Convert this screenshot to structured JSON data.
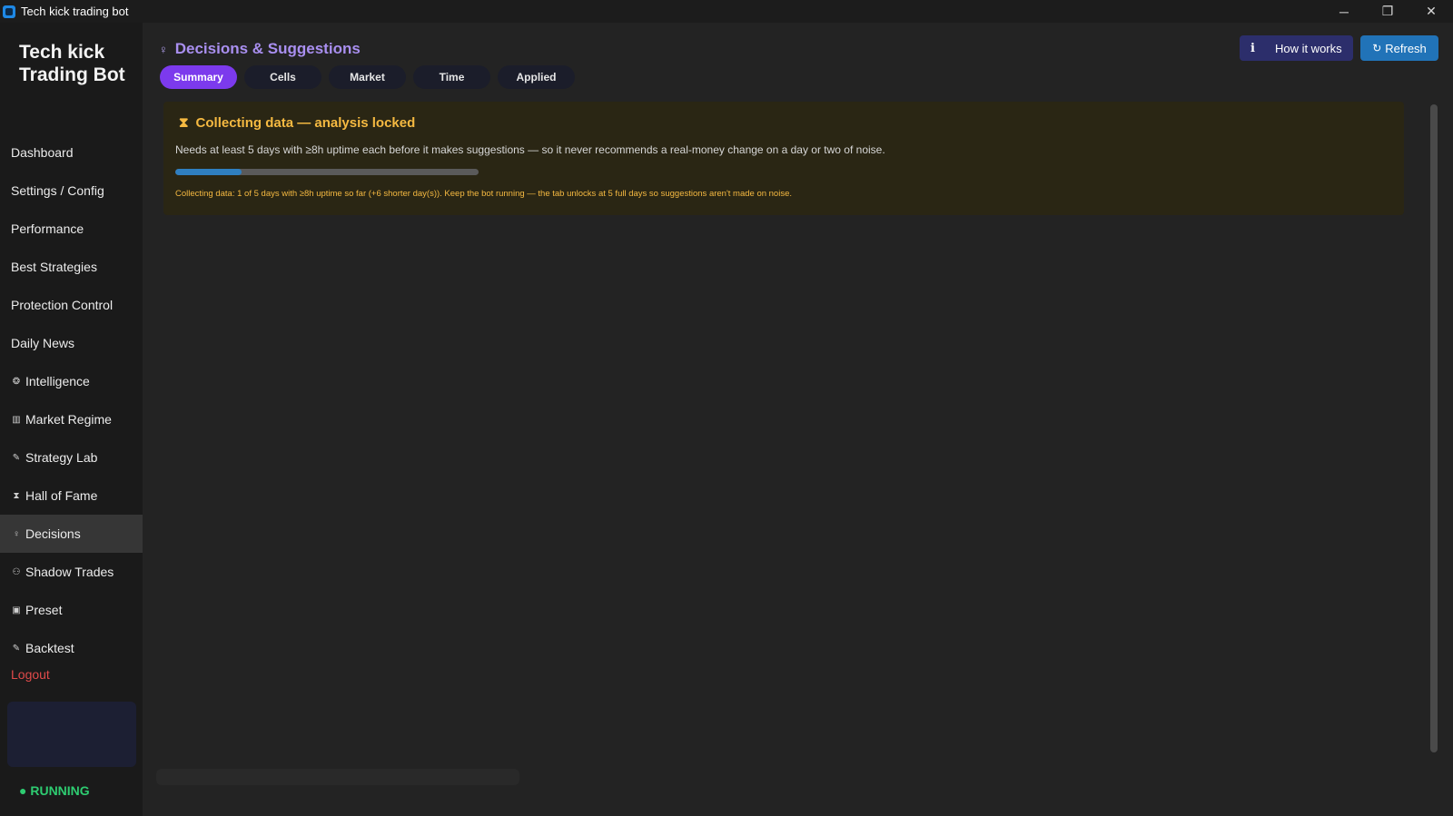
{
  "window": {
    "title": "Tech kick trading bot",
    "controls": {
      "minimize": "─",
      "restore": "❐",
      "close": "✕"
    }
  },
  "sidebar": {
    "brand": "Tech kick Trading Bot",
    "items": [
      {
        "label": "Dashboard",
        "icon": ""
      },
      {
        "label": "Settings / Config",
        "icon": ""
      },
      {
        "label": "Performance",
        "icon": ""
      },
      {
        "label": "Best Strategies",
        "icon": ""
      },
      {
        "label": "Protection Control",
        "icon": ""
      },
      {
        "label": "Daily News",
        "icon": ""
      },
      {
        "label": "Intelligence",
        "icon": "brain-icon"
      },
      {
        "label": "Market Regime",
        "icon": "chart-icon"
      },
      {
        "label": "Strategy Lab",
        "icon": "wrench-icon"
      },
      {
        "label": "Hall of Fame",
        "icon": "hourglass-icon"
      },
      {
        "label": "Decisions",
        "icon": "lightbulb-icon"
      },
      {
        "label": "Shadow Trades",
        "icon": "people-icon"
      },
      {
        "label": "Preset",
        "icon": "gift-icon"
      },
      {
        "label": "Backtest",
        "icon": "wrench-icon"
      }
    ],
    "active_index": 10,
    "logout": "Logout",
    "status": "● RUNNING"
  },
  "header": {
    "title": "Decisions & Suggestions",
    "tabs": [
      "Summary",
      "Cells",
      "Market",
      "Time",
      "Applied"
    ],
    "active_tab": 0,
    "how_it_works": "How it works",
    "refresh": "Refresh"
  },
  "notice": {
    "title": "Collecting data — analysis locked",
    "description": "Needs at least 5 days with ≥8h uptime each before it makes suggestions — so it never recommends a real-money change on a day or two of noise.",
    "progress": 0.22,
    "note": "Collecting data: 1 of 5 days with ≥8h uptime so far (+6 shorter day(s)). Keep the bot running — the tab unlocks at 5 full days so suggestions aren't made on noise."
  },
  "colors": {
    "accent": "#7c3aed",
    "title_accent": "#a98ff0",
    "warning": "#f5b941",
    "running": "#2ecc71",
    "logout": "#e04a4a",
    "refresh": "#2173b8"
  }
}
